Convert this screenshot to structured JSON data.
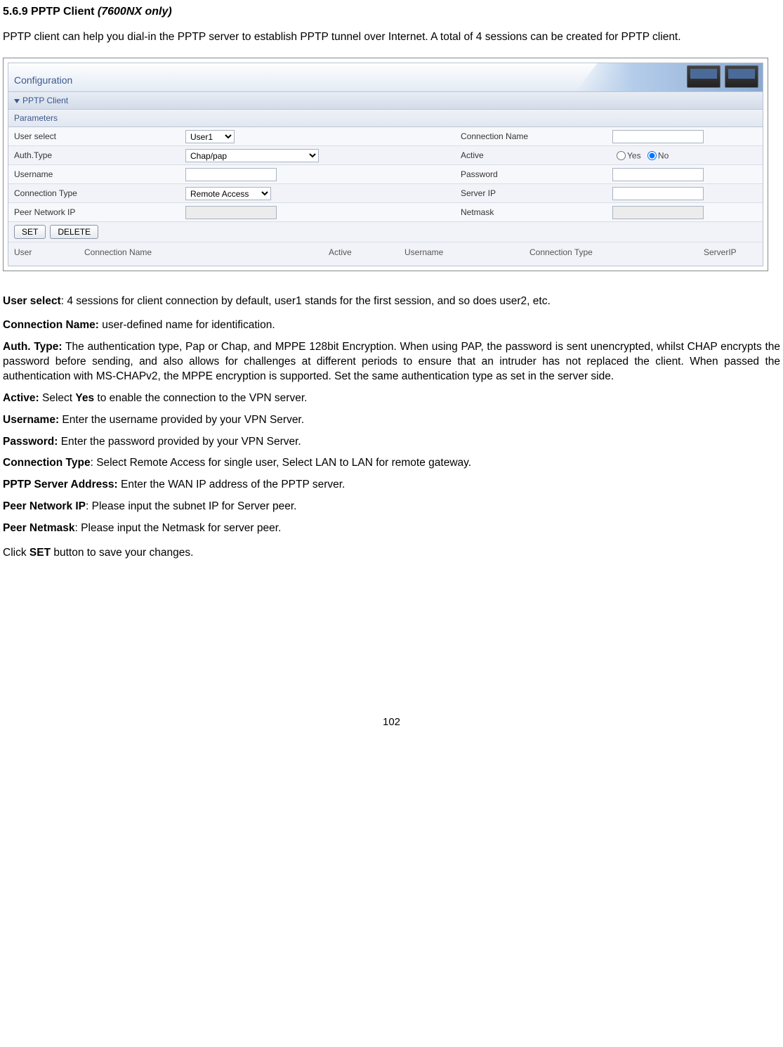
{
  "heading": {
    "number": "5.6.9",
    "title": "PPTP Client",
    "qualifier": "(7600NX only)"
  },
  "intro": "PPTP client can help you dial-in the PPTP server to establish PPTP tunnel over Internet. A total of 4 sessions can be created for PPTP client.",
  "panel": {
    "title": "Configuration",
    "section": "PPTP Client",
    "subsection": "Parameters",
    "rows": {
      "user_select_label": "User select",
      "user_select_value": "User1",
      "connection_name_label": "Connection Name",
      "connection_name_value": "",
      "auth_type_label": "Auth.Type",
      "auth_type_value": "Chap/pap",
      "active_label": "Active",
      "active_yes": "Yes",
      "active_no": "No",
      "username_label": "Username",
      "username_value": "",
      "password_label": "Password",
      "password_value": "",
      "connection_type_label": "Connection Type",
      "connection_type_value": "Remote Access",
      "server_ip_label": "Server IP",
      "server_ip_value": "",
      "peer_network_ip_label": "Peer Network IP",
      "peer_network_ip_value": "",
      "netmask_label": "Netmask",
      "netmask_value": ""
    },
    "buttons": {
      "set": "SET",
      "delete": "DELETE"
    },
    "list_headers": {
      "user": "User",
      "connection_name": "Connection Name",
      "active": "Active",
      "username": "Username",
      "connection_type": "Connection Type",
      "server_ip": "ServerIP"
    }
  },
  "defs": {
    "user_select_term": "User select",
    "user_select_text": ": 4 sessions for client connection by default, user1 stands for the first session, and so does user2, etc.",
    "connection_name_term": "Connection Name:",
    "connection_name_text": " user-defined name for identification.",
    "auth_type_term": "Auth. Type:",
    "auth_type_text": " The authentication type, Pap or Chap, and MPPE 128bit Encryption. When using PAP, the password is sent unencrypted, whilst CHAP encrypts the password before sending, and also allows for challenges at different periods to ensure that an intruder has not replaced the client. When passed the authentication with MS-CHAPv2, the MPPE encryption is supported. Set the same authentication type as set in the server side.",
    "active_term": "Active:",
    "active_text_pre": " Select ",
    "active_text_bold": "Yes",
    "active_text_post": " to enable the connection to the VPN server.",
    "username_term": "Username:",
    "username_text": " Enter the username provided by your VPN Server.",
    "password_term": "Password:",
    "password_text": " Enter the password provided by your VPN Server.",
    "connection_type_term": "Connection Type",
    "connection_type_text": ": Select Remote Access for single user, Select LAN to LAN for remote gateway.",
    "pptp_server_term": "PPTP Server Address:",
    "pptp_server_text": " Enter the WAN IP address of the PPTP server.",
    "peer_network_ip_term": "Peer Network IP",
    "peer_network_ip_text": ": Please input the subnet IP for Server peer.",
    "peer_netmask_term": "Peer Netmask",
    "peer_netmask_text": ": Please input the Netmask for server peer.",
    "closing_pre": "Click ",
    "closing_bold": "SET",
    "closing_post": " button to save your changes."
  },
  "page_number": "102"
}
